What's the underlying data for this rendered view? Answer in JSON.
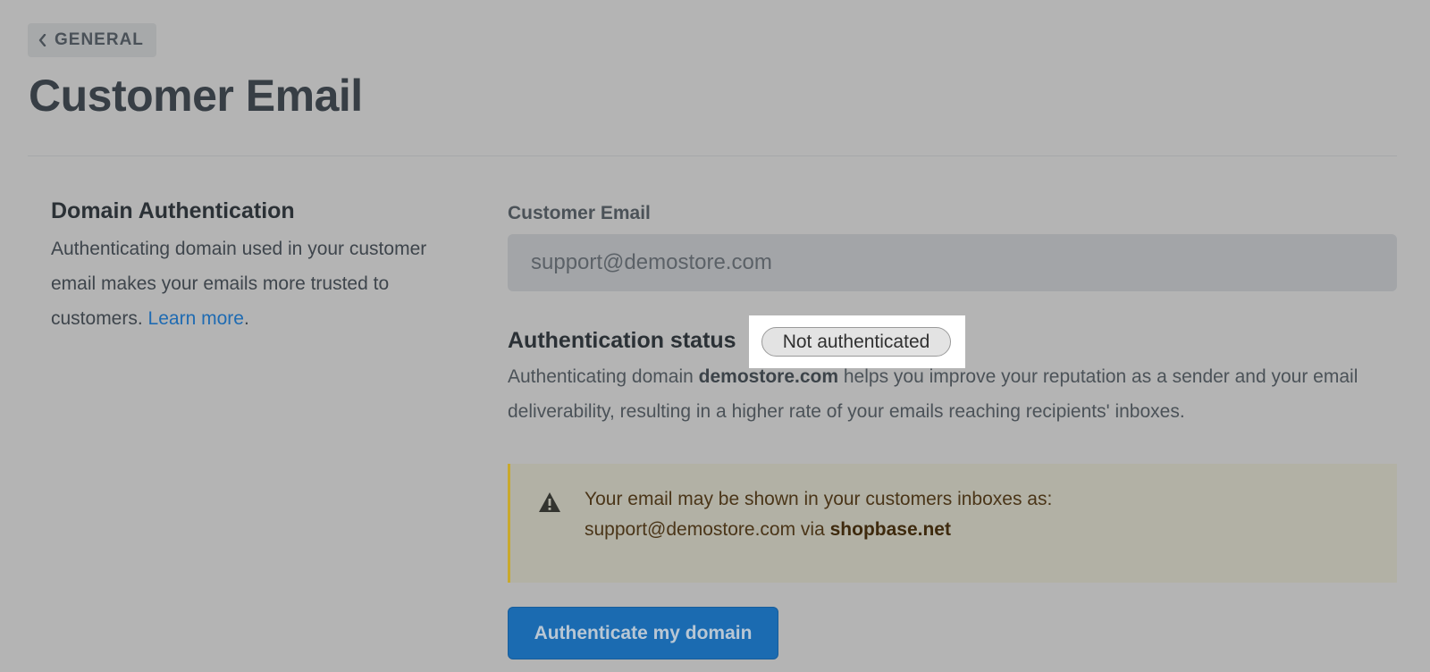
{
  "breadcrumb": {
    "back_label": "GENERAL",
    "icon": "chevron-left-icon"
  },
  "page": {
    "title": "Customer Email"
  },
  "domain_section": {
    "title": "Domain Authentication",
    "description": "Authenticating domain used in your customer email makes your emails more trusted to customers.",
    "link_label": "Learn more",
    "link_suffix": "."
  },
  "email_field": {
    "label": "Customer Email",
    "value": "support@demostore.com"
  },
  "status": {
    "title": "Authentication status",
    "badge": "Not authenticated",
    "desc_prefix": "Authenticating domain",
    "domain": "demostore.com",
    "desc_suffix": "helps you improve your reputation as a sender and your email deliverability, resulting in a higher rate of your emails reaching recipients' inboxes."
  },
  "warning": {
    "icon": "warning-triangle-icon",
    "line1": "Your email may be shown in your customers inboxes as:",
    "line2_prefix": "support@demostore.com via",
    "line2_domain": "shopbase.net"
  },
  "actions": {
    "authenticate_label": "Authenticate my domain"
  },
  "colors": {
    "link": "#1f6bb2",
    "primary_button": "#1b6bb1",
    "warning_border": "#c9a92c",
    "badge_bg": "#e3e3e3"
  }
}
